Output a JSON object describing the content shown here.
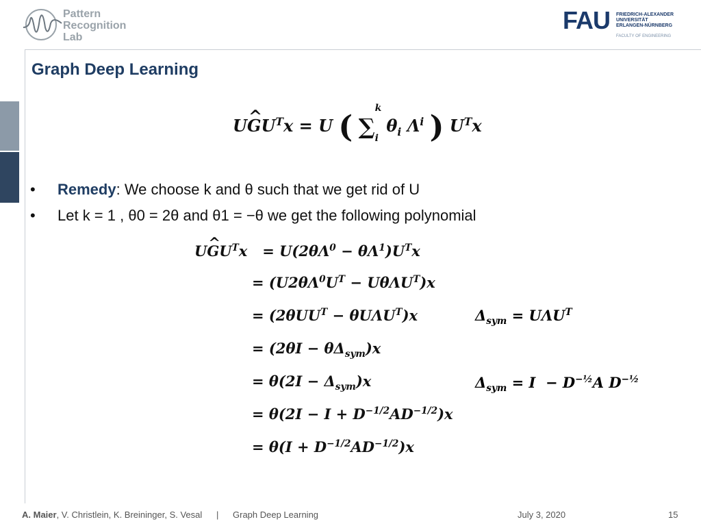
{
  "header": {
    "lab_name": [
      "Pattern",
      "Recognition",
      "Lab"
    ],
    "university_logo_word": "FAU",
    "university_name": [
      "FRIEDRICH-ALEXANDER",
      "UNIVERSITÄT",
      "ERLANGEN-NÜRNBERG"
    ],
    "faculty": "FACULTY OF ENGINEERING"
  },
  "slide": {
    "title": "Graph Deep Learning",
    "bullets": [
      {
        "label": "Remedy",
        "text": ": We choose k and θ  such that we get rid of U"
      },
      {
        "label": "",
        "text": "Let k = 1 ,  θ0 = 2θ and θ1 = −θ we get the following polynomial"
      }
    ]
  },
  "footer": {
    "authors_bold": "A. Maier",
    "authors_rest": ", V. Christlein, K. Breininger, S. Vesal",
    "separator": "|",
    "topic": "Graph Deep Learning",
    "date": "July 3, 2020",
    "page": "15"
  }
}
